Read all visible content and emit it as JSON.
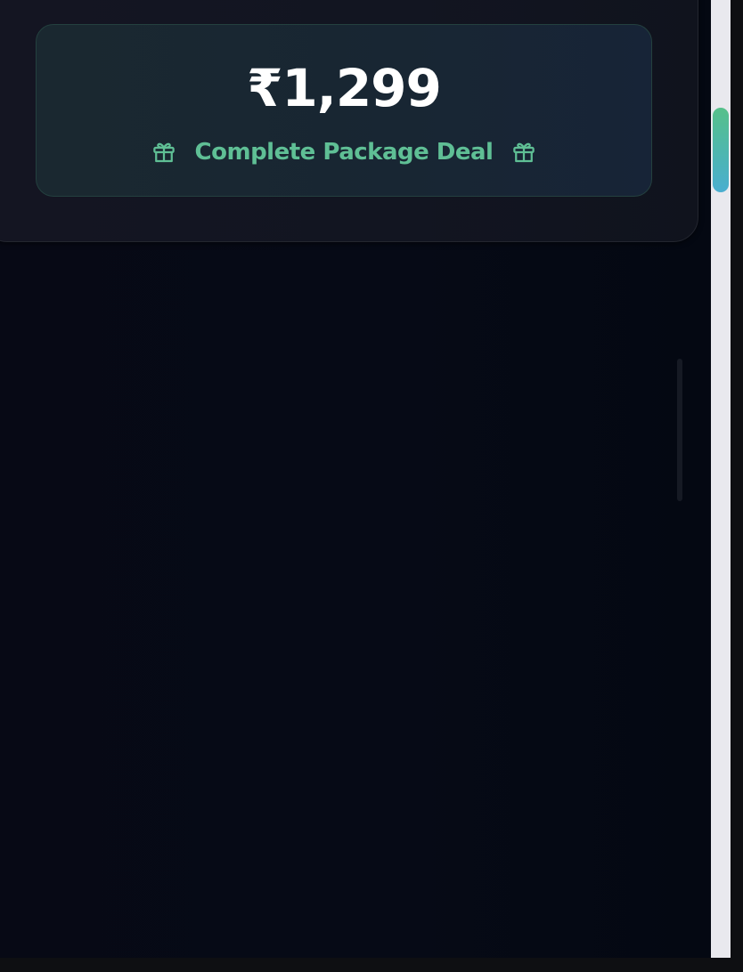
{
  "package_card": {
    "price": "₹1,299",
    "deal_label": "Complete Package Deal",
    "icons": {
      "left": "gift-icon",
      "right": "gift-icon"
    }
  },
  "colors": {
    "accent": "#5fbf95",
    "price_text": "#ffffff",
    "background": "#060a16",
    "scroll_thumb_top": "#56c08a",
    "scroll_thumb_bottom": "#4aaed0"
  }
}
